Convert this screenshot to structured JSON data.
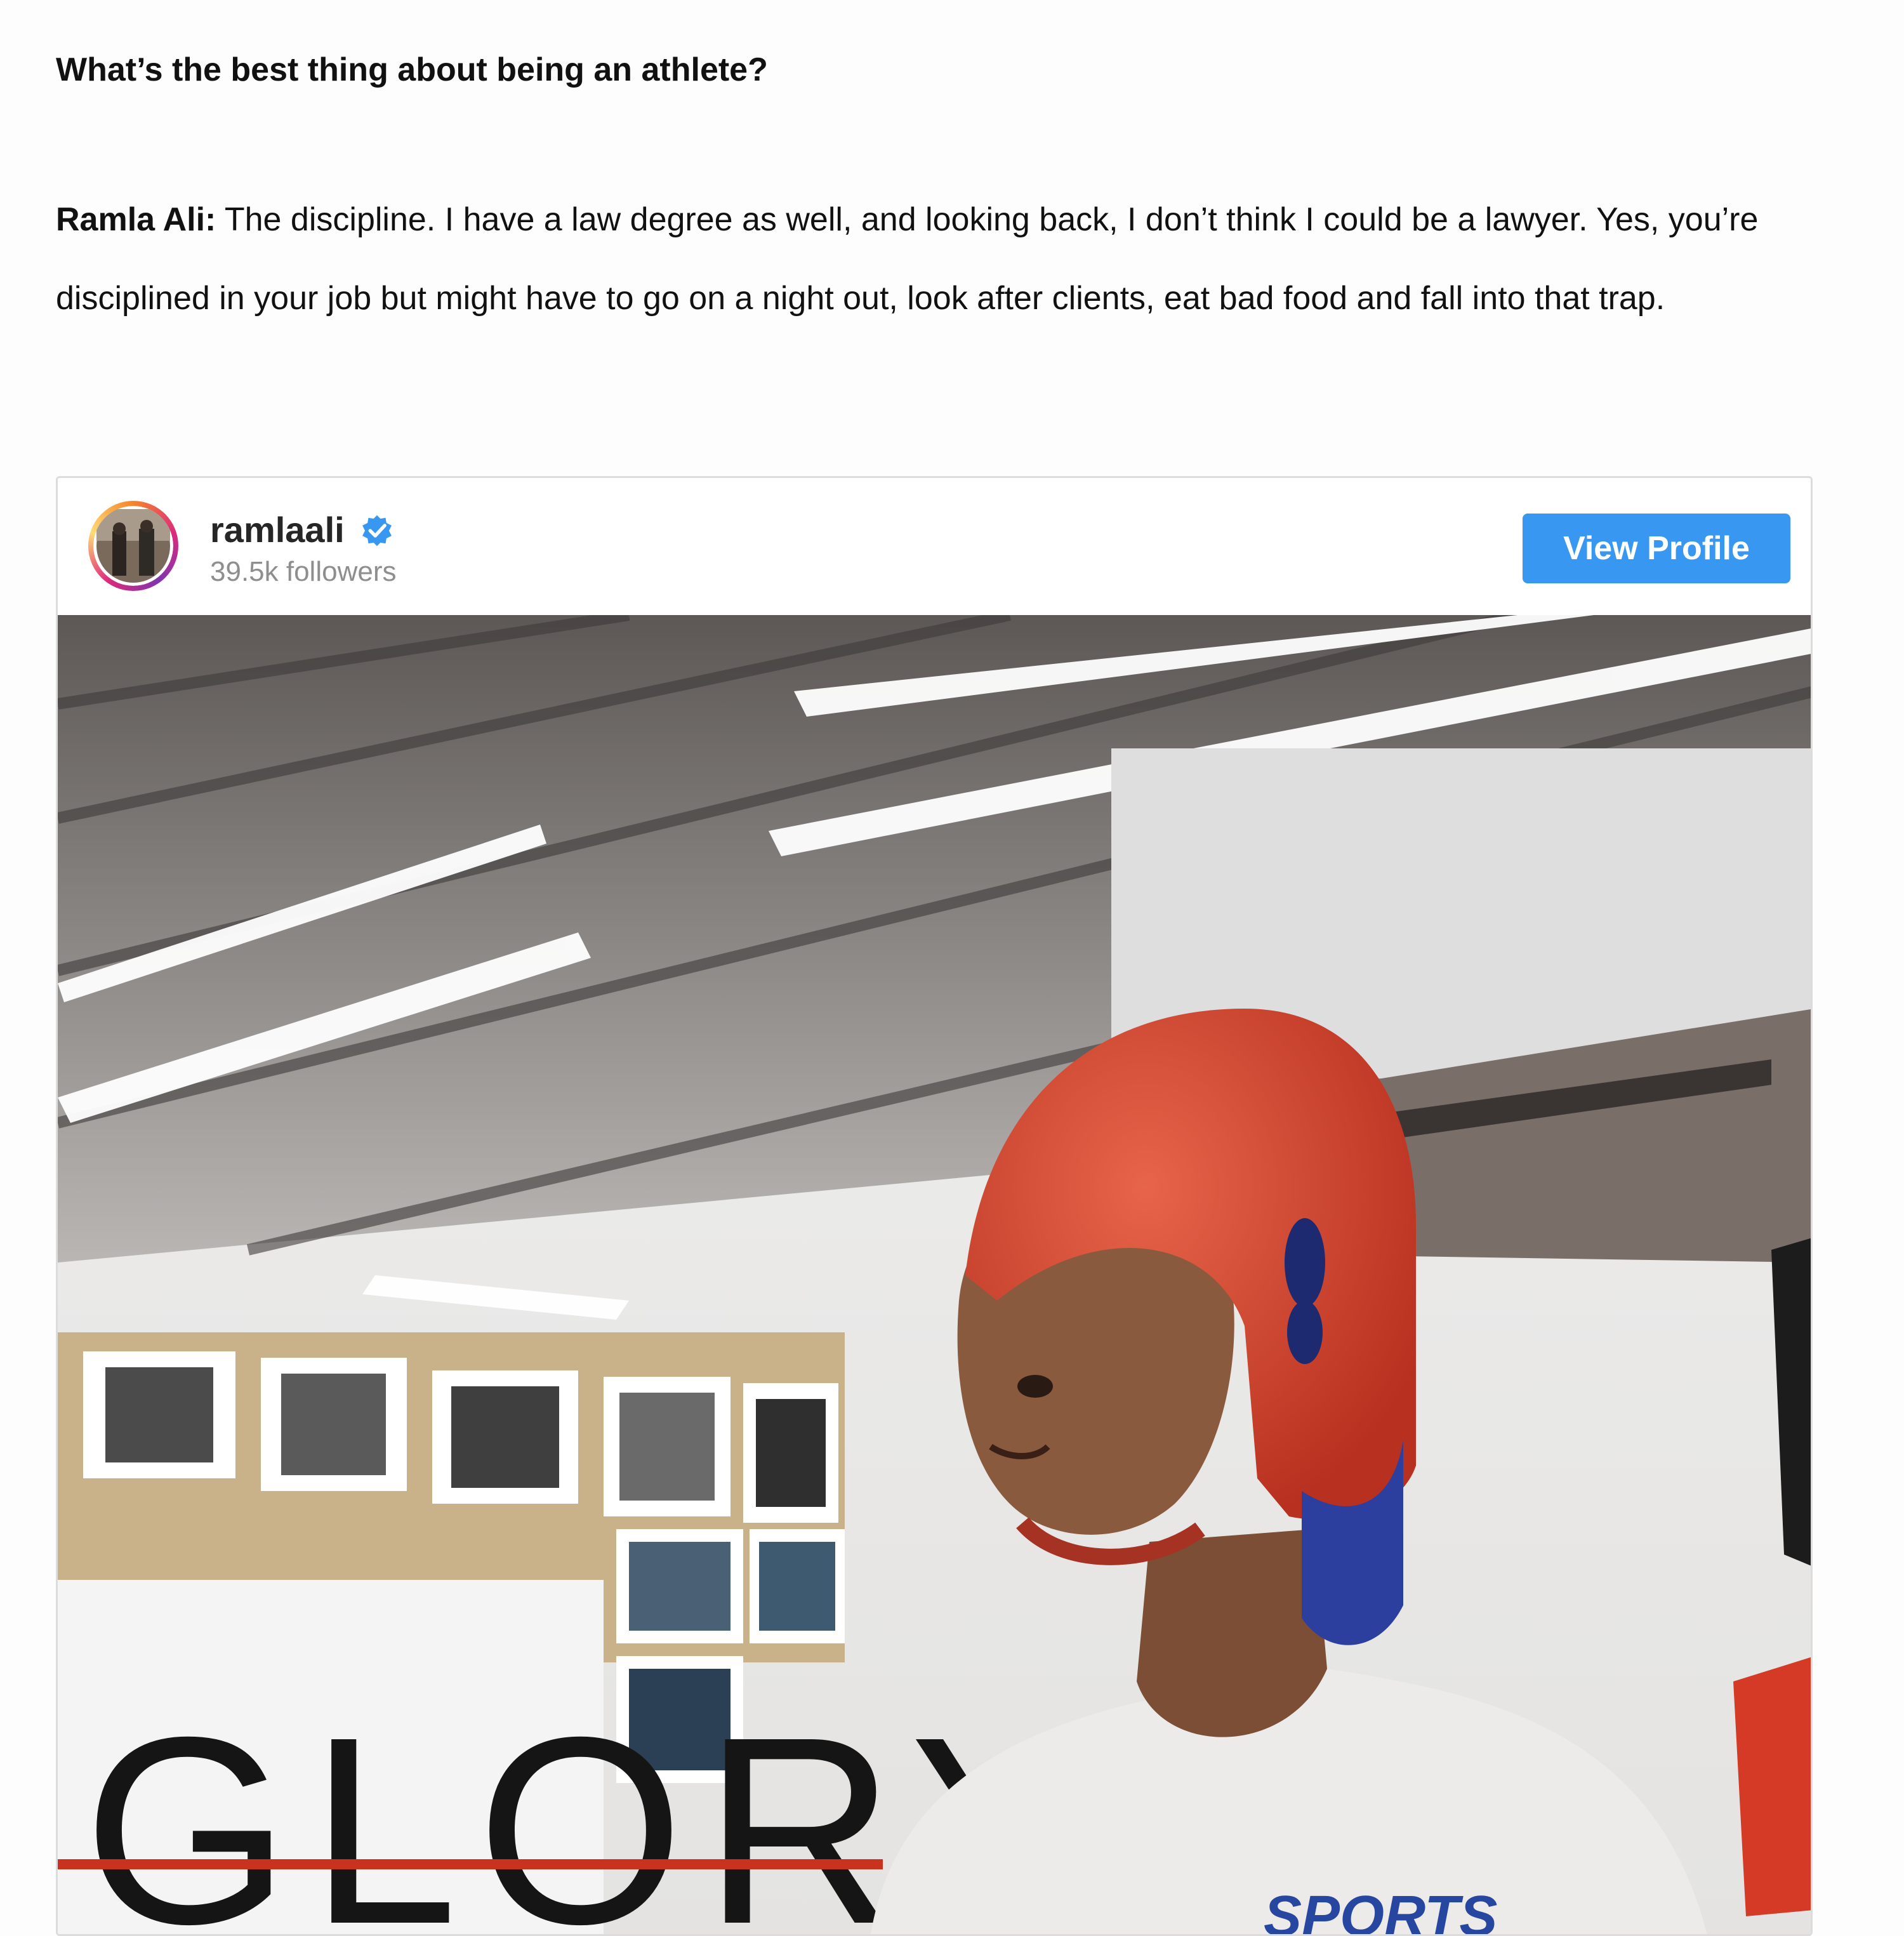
{
  "article": {
    "question": "What’s the best thing about being an athlete?",
    "answer_speaker": "Ramla Ali:",
    "answer_text": " The discipline. I have a law degree as well, and looking back, I don’t think I could be a lawyer. Yes, you’re disciplined in your job but might have to go on a night out, look after clients, eat bad food and fall into that trap."
  },
  "instagram_embed": {
    "username": "ramlaali",
    "verified_icon": "verified-badge-icon",
    "followers": "39.5k followers",
    "view_profile_label": "View Profile",
    "photo_sign_text": "GLORY",
    "shirt_text": "SPORTS",
    "colors": {
      "button": "#3897f0",
      "verified": "#3897f0",
      "headgear": "#d6402c"
    }
  }
}
